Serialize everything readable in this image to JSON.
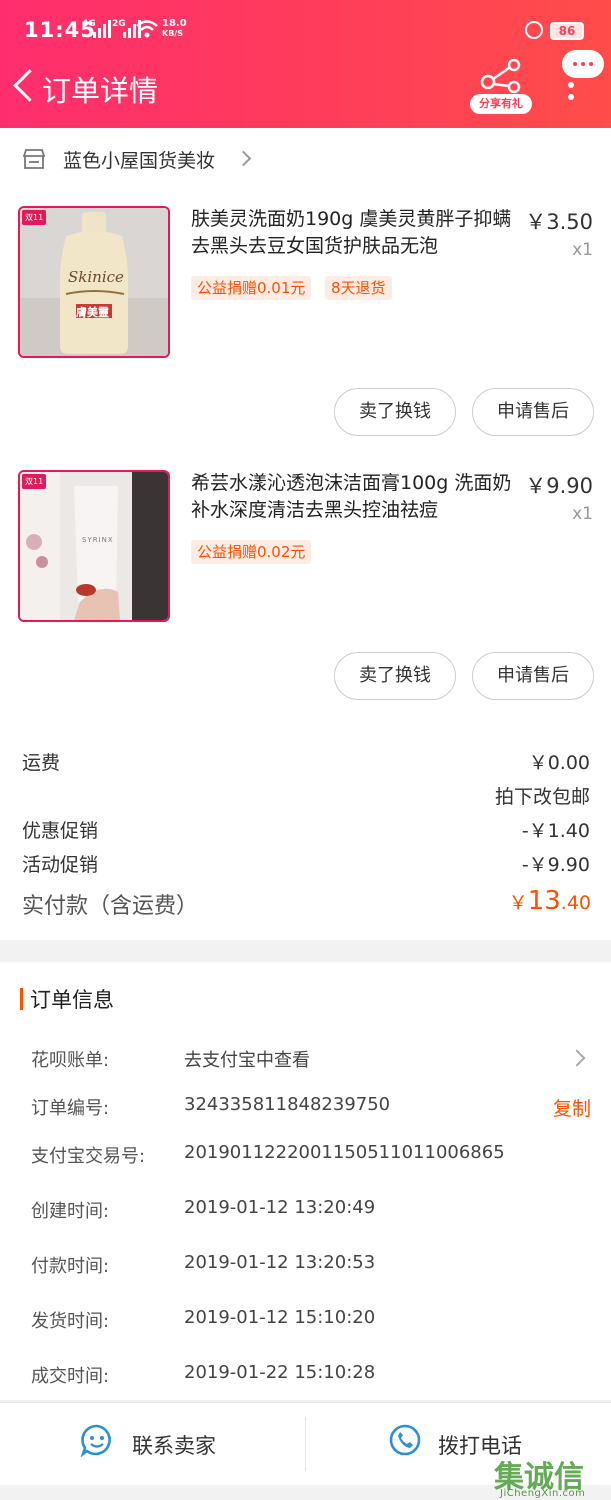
{
  "status_bar": {
    "time": "11:45",
    "net_left": "4G",
    "net_right": "2G",
    "speed_value": "18.0",
    "speed_unit": "KB/S",
    "battery": "86"
  },
  "header": {
    "title": "订单详情",
    "share_label": "分享有礼"
  },
  "shop": {
    "name": "蓝色小屋国货美妆"
  },
  "products": [
    {
      "tag": "双11",
      "title": "肤美灵洗面奶190g 虞美灵黄胖子抑螨去黑头去豆女国货护肤品无泡",
      "price": "￥3.50",
      "qty": "x1",
      "badges": [
        "公益捐赠0.01元",
        "8天退货"
      ],
      "image_text": "Skinice",
      "image_brand": "膚美靈",
      "buttons": [
        "卖了换钱",
        "申请售后"
      ]
    },
    {
      "tag": "双11",
      "title": "希芸水漾沁透泡沫洁面膏100g 洗面奶补水深度清洁去黑头控油祛痘",
      "price": "￥9.90",
      "qty": "x1",
      "badges": [
        "公益捐赠0.02元"
      ],
      "image_text": "SYRINX",
      "buttons": [
        "卖了换钱",
        "申请售后"
      ]
    }
  ],
  "fees": {
    "shipping_label": "运费",
    "shipping_value": "￥0.00",
    "shipping_note": "拍下改包邮",
    "discount_label": "优惠促销",
    "discount_value": "-￥1.40",
    "event_label": "活动促销",
    "event_value": "-￥9.90",
    "total_label": "实付款（含运费）",
    "total_currency": "￥",
    "total_int": "13",
    "total_dec": ".40"
  },
  "order_info": {
    "title": "订单信息",
    "rows": [
      {
        "label": "花呗账单:",
        "value": "去支付宝中查看"
      },
      {
        "label": "订单编号:",
        "value": "324335811848239750",
        "action": "复制"
      },
      {
        "label": "支付宝交易号:",
        "value": "2019011222001150511011006865"
      },
      {
        "label": "创建时间:",
        "value": "2019-01-12 13:20:49"
      },
      {
        "label": "付款时间:",
        "value": "2019-01-12 13:20:53"
      },
      {
        "label": "发货时间:",
        "value": "2019-01-12 15:10:20"
      },
      {
        "label": "成交时间:",
        "value": "2019-01-22 15:10:28"
      }
    ]
  },
  "bottom_bar": {
    "contact_label": "联系卖家",
    "call_label": "拨打电话"
  },
  "watermark": {
    "main": "集诚信",
    "sub": "JiChengXin.com"
  },
  "colors": {
    "accent": "#ff5000",
    "header_start": "#ff2d6e",
    "header_end": "#ff4d4a",
    "thumb_border": "#e3195a",
    "icon_blue": "#2e8fd6"
  }
}
